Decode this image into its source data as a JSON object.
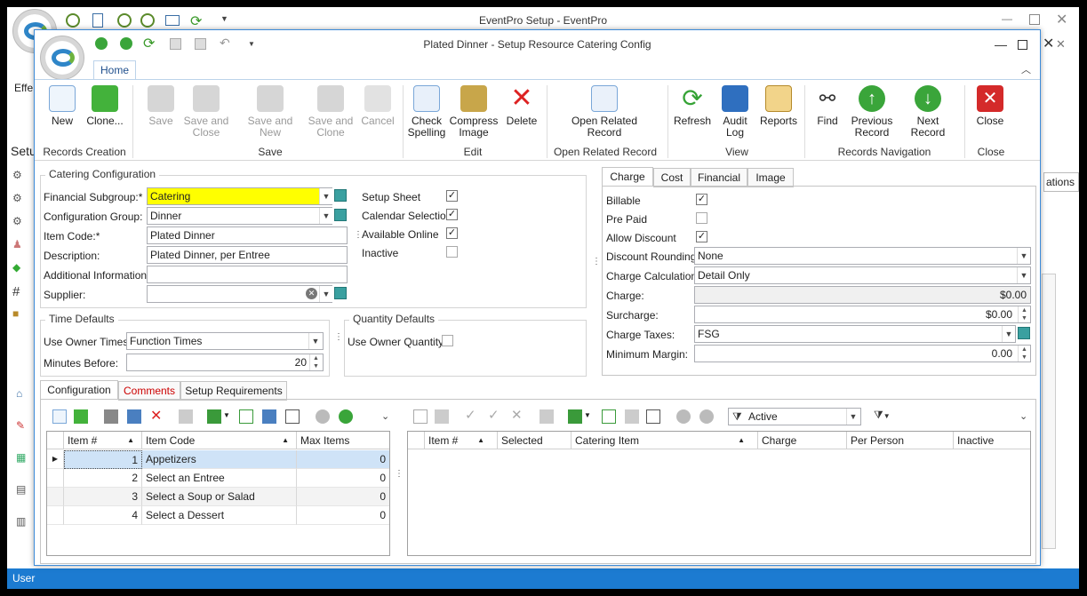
{
  "outer": {
    "title": "EventPro Setup - EventPro",
    "effe": "Effe",
    "setu": "Setu",
    "ations": "ations",
    "status": "User"
  },
  "window": {
    "title": "Plated Dinner - Setup Resource Catering Config",
    "ribbon_tab": "Home"
  },
  "ribbon": {
    "buttons": [
      {
        "label": "New",
        "state": "enabled"
      },
      {
        "label": "Clone...",
        "state": "enabled"
      },
      {
        "label": "Save",
        "state": "disabled"
      },
      {
        "label": "Save and Close",
        "state": "disabled"
      },
      {
        "label": "Save and New",
        "state": "disabled"
      },
      {
        "label": "Save and Clone",
        "state": "disabled"
      },
      {
        "label": "Cancel",
        "state": "disabled"
      },
      {
        "label": "Check Spelling",
        "state": "enabled"
      },
      {
        "label": "Compress Image",
        "state": "enabled"
      },
      {
        "label": "Delete",
        "state": "enabled"
      },
      {
        "label": "Open Related Record",
        "state": "enabled"
      },
      {
        "label": "Refresh",
        "state": "enabled"
      },
      {
        "label": "Audit Log",
        "state": "enabled"
      },
      {
        "label": "Reports",
        "state": "enabled"
      },
      {
        "label": "Find",
        "state": "enabled"
      },
      {
        "label": "Previous Record",
        "state": "enabled"
      },
      {
        "label": "Next Record",
        "state": "enabled"
      },
      {
        "label": "Close",
        "state": "enabled"
      }
    ],
    "groups": [
      "Records Creation",
      "Save",
      "Edit",
      "Open Related Record",
      "View",
      "Records Navigation",
      "Close"
    ]
  },
  "catering": {
    "title": "Catering Configuration",
    "financial_subgroup_label": "Financial Subgroup:*",
    "financial_subgroup": "Catering",
    "config_group_label": "Configuration Group:",
    "config_group": "Dinner",
    "item_code_label": "Item Code:*",
    "item_code": "Plated Dinner",
    "description_label": "Description:",
    "description": "Plated Dinner, per Entree",
    "additional_label": "Additional Information:",
    "additional": "",
    "supplier_label": "Supplier:",
    "supplier": "",
    "setup_sheet_label": "Setup Sheet",
    "setup_sheet": true,
    "calendar_selection_label": "Calendar Selection",
    "calendar_selection": true,
    "available_online_label": "Available Online",
    "available_online": true,
    "inactive_label": "Inactive",
    "inactive": false
  },
  "time_defaults": {
    "title": "Time Defaults",
    "use_owner_times_label": "Use Owner Times:",
    "use_owner_times": "Function Times",
    "minutes_before_label": "Minutes Before:",
    "minutes_before": "20"
  },
  "quantity_defaults": {
    "title": "Quantity Defaults",
    "use_owner_quantity_label": "Use Owner Quantity",
    "use_owner_quantity": false
  },
  "charge_tabs": [
    "Charge",
    "Cost",
    "Financial",
    "Image"
  ],
  "charge": {
    "billable_label": "Billable",
    "billable": true,
    "pre_paid_label": "Pre Paid",
    "pre_paid": false,
    "allow_discount_label": "Allow Discount",
    "allow_discount": true,
    "discount_rounding_label": "Discount Rounding:",
    "discount_rounding": "None",
    "charge_calculation_label": "Charge Calculation:",
    "charge_calculation": "Detail Only",
    "charge_label": "Charge:",
    "charge": "$0.00",
    "surcharge_label": "Surcharge:",
    "surcharge": "$0.00",
    "charge_taxes_label": "Charge Taxes:",
    "charge_taxes": "FSG",
    "minimum_margin_label": "Minimum Margin:",
    "minimum_margin": "0.00"
  },
  "bottom_tabs": [
    "Configuration",
    "Comments",
    "Setup Requirements"
  ],
  "config_grid": {
    "headers": [
      "Item #",
      "Item Code",
      "Max Items"
    ],
    "rows": [
      [
        "1",
        "Appetizers",
        "0"
      ],
      [
        "2",
        "Select an Entree",
        "0"
      ],
      [
        "3",
        "Select a Soup or Salad",
        "0"
      ],
      [
        "4",
        "Select a Dessert",
        "0"
      ]
    ]
  },
  "item_grid": {
    "filter": "Active",
    "headers": [
      "Item #",
      "Selected",
      "Catering Item",
      "Charge",
      "Per Person",
      "Inactive"
    ]
  },
  "colors": {
    "accent": "#1c7bd1",
    "highlight": "#ffff00",
    "selected_row": "#cfe3f7"
  }
}
